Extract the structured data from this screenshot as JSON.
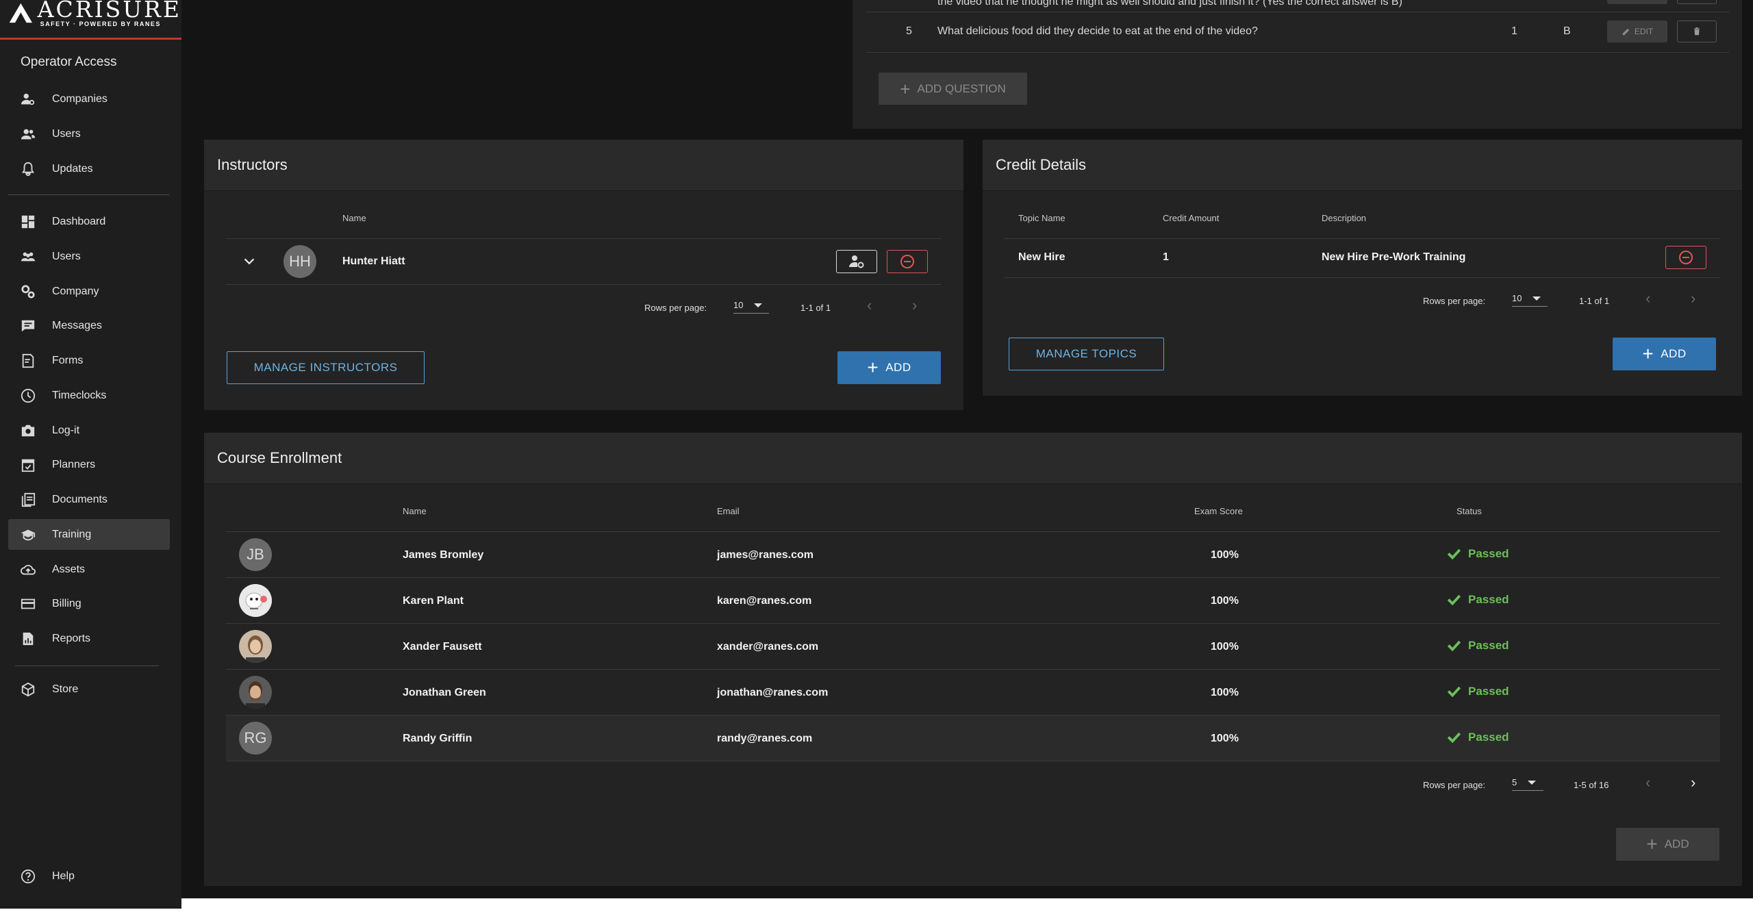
{
  "brand": {
    "name": "ACRISURE",
    "tagline": "SAFETY · POWERED BY RANES"
  },
  "sidebar": {
    "section_title": "Operator Access",
    "operator_items": [
      {
        "label": "Companies",
        "icon": "companies-icon"
      },
      {
        "label": "Users",
        "icon": "users-icon"
      },
      {
        "label": "Updates",
        "icon": "bell-icon"
      }
    ],
    "main_items": [
      {
        "label": "Dashboard",
        "icon": "dashboard-icon"
      },
      {
        "label": "Users",
        "icon": "users-icon"
      },
      {
        "label": "Company",
        "icon": "gears-icon"
      },
      {
        "label": "Messages",
        "icon": "message-icon"
      },
      {
        "label": "Forms",
        "icon": "form-icon"
      },
      {
        "label": "Timeclocks",
        "icon": "clock-icon"
      },
      {
        "label": "Log-it",
        "icon": "camera-icon"
      },
      {
        "label": "Planners",
        "icon": "calendar-icon"
      },
      {
        "label": "Documents",
        "icon": "documents-icon"
      },
      {
        "label": "Training",
        "icon": "graduation-cap-icon",
        "active": true
      },
      {
        "label": "Assets",
        "icon": "cloud-icon"
      },
      {
        "label": "Billing",
        "icon": "credit-card-icon"
      },
      {
        "label": "Reports",
        "icon": "report-icon"
      }
    ],
    "store_label": "Store",
    "help_label": "Help"
  },
  "questions": {
    "partial_text": "the video that he thought he might as well should and just finish it? (Yes the correct answer is B)",
    "row": {
      "number": "5",
      "question": "What delicious food did they decide to eat at the end of the video?",
      "points": "1",
      "answer": "B",
      "edit_label": "EDIT"
    },
    "add_question_label": "ADD QUESTION"
  },
  "instructors": {
    "title": "Instructors",
    "col_name": "Name",
    "rows": [
      {
        "initials": "HH",
        "name": "Hunter Hiatt"
      }
    ],
    "rows_per_page_label": "Rows per page:",
    "rows_per_page": "10",
    "range": "1-1 of 1",
    "manage_label": "MANAGE INSTRUCTORS",
    "add_label": "ADD"
  },
  "credit_details": {
    "title": "Credit Details",
    "col_topic": "Topic Name",
    "col_amount": "Credit Amount",
    "col_description": "Description",
    "rows": [
      {
        "topic": "New Hire",
        "amount": "1",
        "description": "New Hire Pre-Work Training"
      }
    ],
    "rows_per_page_label": "Rows per page:",
    "rows_per_page": "10",
    "range": "1-1 of 1",
    "manage_label": "MANAGE TOPICS",
    "add_label": "ADD"
  },
  "enrollment": {
    "title": "Course Enrollment",
    "col_name": "Name",
    "col_email": "Email",
    "col_score": "Exam Score",
    "col_status": "Status",
    "rows": [
      {
        "initials": "JB",
        "name": "James Bromley",
        "email": "james@ranes.com",
        "score": "100%",
        "status": "Passed",
        "avatar": "initials"
      },
      {
        "initials": "",
        "name": "Karen Plant",
        "email": "karen@ranes.com",
        "score": "100%",
        "status": "Passed",
        "avatar": "cartoon"
      },
      {
        "initials": "",
        "name": "Xander Fausett",
        "email": "xander@ranes.com",
        "score": "100%",
        "status": "Passed",
        "avatar": "photo"
      },
      {
        "initials": "",
        "name": "Jonathan Green",
        "email": "jonathan@ranes.com",
        "score": "100%",
        "status": "Passed",
        "avatar": "photo"
      },
      {
        "initials": "RG",
        "name": "Randy Griffin",
        "email": "randy@ranes.com",
        "score": "100%",
        "status": "Passed",
        "avatar": "initials"
      }
    ],
    "rows_per_page_label": "Rows per page:",
    "rows_per_page": "5",
    "range": "1-5 of 16",
    "add_label": "ADD"
  },
  "colors": {
    "accent": "#2f72ae",
    "link": "#6cb3e6",
    "success": "#6cbf5a",
    "danger": "#e05555",
    "brand_red": "#c0392b"
  }
}
